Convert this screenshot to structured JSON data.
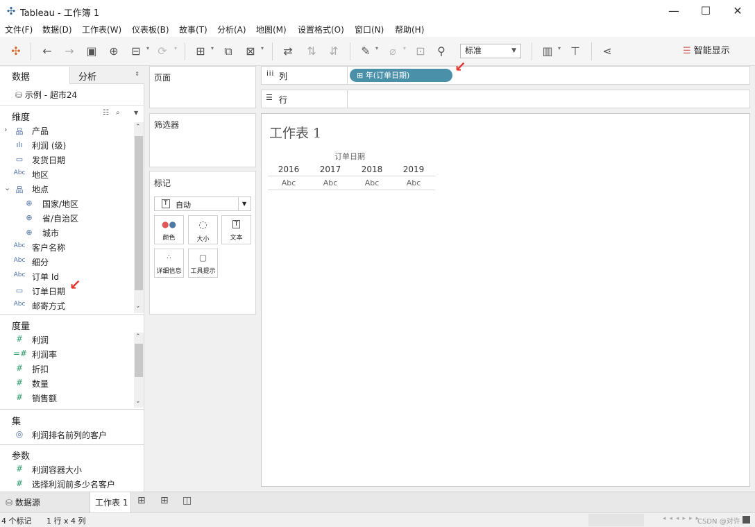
{
  "window": {
    "title": "Tableau - 工作簿 1",
    "minimize": "—",
    "maximize": "☐",
    "close": "✕"
  },
  "menu": [
    "文件(F)",
    "数据(D)",
    "工作表(W)",
    "仪表板(B)",
    "故事(T)",
    "分析(A)",
    "地图(M)",
    "设置格式(O)",
    "窗口(N)",
    "帮助(H)"
  ],
  "toolbar": {
    "fit_select": "标准",
    "show_me": "智能显示"
  },
  "left_pane": {
    "tab_data": "数据",
    "tab_analysis": "分析",
    "datasource": "示例 - 超市24",
    "dimensions_header": "维度",
    "dimensions": [
      {
        "label": "产品",
        "icon": "hierarchy-icon",
        "glyph": "品",
        "expand": "›"
      },
      {
        "label": "利润 (级)",
        "icon": "bin-icon",
        "glyph": "ılı"
      },
      {
        "label": "发货日期",
        "icon": "date-icon",
        "glyph": "▭"
      },
      {
        "label": "地区",
        "icon": "abc-icon",
        "glyph": "Abc"
      },
      {
        "label": "地点",
        "icon": "hierarchy-icon",
        "glyph": "品",
        "expand": "⌄"
      },
      {
        "label": "国家/地区",
        "icon": "globe-icon",
        "glyph": "⊕",
        "indent": true
      },
      {
        "label": "省/自治区",
        "icon": "globe-icon",
        "glyph": "⊕",
        "indent": true
      },
      {
        "label": "城市",
        "icon": "globe-icon",
        "glyph": "⊕",
        "indent": true
      },
      {
        "label": "客户名称",
        "icon": "abc-icon",
        "glyph": "Abc"
      },
      {
        "label": "细分",
        "icon": "abc-icon",
        "glyph": "Abc"
      },
      {
        "label": "订单 Id",
        "icon": "abc-icon",
        "glyph": "Abc"
      },
      {
        "label": "订单日期",
        "icon": "date-icon",
        "glyph": "▭"
      },
      {
        "label": "邮寄方式",
        "icon": "abc-icon",
        "glyph": "Abc"
      }
    ],
    "measures_header": "度量",
    "measures": [
      {
        "label": "利润",
        "glyph": "#"
      },
      {
        "label": "利润率",
        "glyph": "=#"
      },
      {
        "label": "折扣",
        "glyph": "#"
      },
      {
        "label": "数量",
        "glyph": "#"
      },
      {
        "label": "销售额",
        "glyph": "#"
      }
    ],
    "sets_header": "集",
    "sets": [
      {
        "label": "利润排名前列的客户",
        "glyph": "◎"
      }
    ],
    "params_header": "参数",
    "params": [
      {
        "label": "利润容器大小",
        "glyph": "#"
      },
      {
        "label": "选择利润前多少名客户",
        "glyph": "#"
      }
    ]
  },
  "shelves": {
    "pages": "页面",
    "filters": "筛选器",
    "marks": "标记",
    "mark_type": "自动",
    "mark_buttons": [
      "颜色",
      "大小",
      "文本",
      "详细信息",
      "工具提示"
    ],
    "columns_label": "列",
    "rows_label": "行",
    "columns_pill": "年(订单日期)",
    "columns_pill_prefix": "⊞"
  },
  "view": {
    "sheet_title": "工作表 1",
    "header_field": "订单日期",
    "years": [
      "2016",
      "2017",
      "2018",
      "2019"
    ],
    "cells": [
      "Abc",
      "Abc",
      "Abc",
      "Abc"
    ]
  },
  "bottom": {
    "datasource_tab": "数据源",
    "sheet_tab": "工作表 1"
  },
  "status": {
    "marks": "4 个标记",
    "shape": "1 行 x 4 列",
    "watermark": "CSDN @对许"
  },
  "colors": {
    "pill": "#4a90a8",
    "accent_arrow": "#e5322d"
  }
}
